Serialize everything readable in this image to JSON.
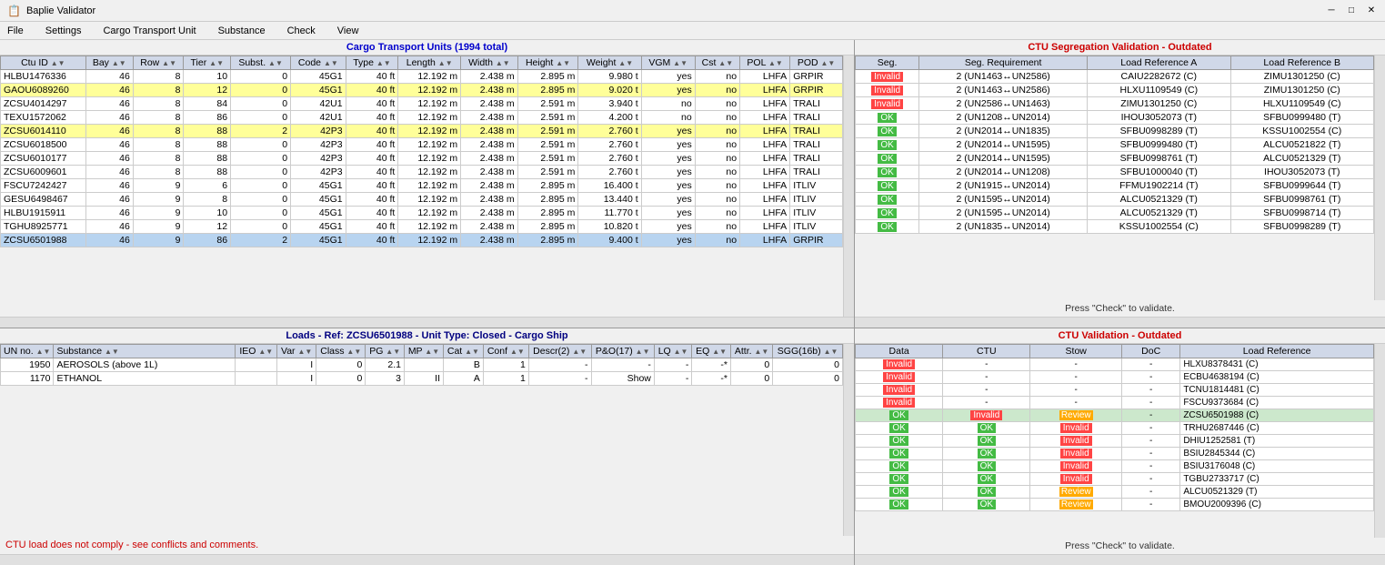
{
  "app": {
    "title": "Baplie Validator",
    "icon": "📋"
  },
  "menu": {
    "items": [
      "File",
      "Settings",
      "Cargo Transport Unit",
      "Substance",
      "Check",
      "View"
    ]
  },
  "ctu_section": {
    "title": "Cargo Transport Units (1994 total)",
    "columns": [
      "Ctu ID",
      "Bay",
      "Row",
      "Tier",
      "Subst.",
      "Code",
      "Type",
      "Length",
      "Width",
      "Height",
      "Weight",
      "VGM",
      "Cst",
      "POL",
      "POD"
    ],
    "rows": [
      {
        "id": "HLBU1476336",
        "bay": "46",
        "row": "8",
        "tier": "10",
        "subst": "0",
        "code": "45G1",
        "type": "40 ft",
        "length": "12.192 m",
        "width": "2.438 m",
        "height": "2.895 m",
        "weight": "9.980 t",
        "vgm": "yes",
        "cst": "no",
        "pol": "LHFA",
        "pod": "GRPIR",
        "style": "normal"
      },
      {
        "id": "GAOU6089260",
        "bay": "46",
        "row": "8",
        "tier": "12",
        "subst": "0",
        "code": "45G1",
        "type": "40 ft",
        "length": "12.192 m",
        "width": "2.438 m",
        "height": "2.895 m",
        "weight": "9.020 t",
        "vgm": "yes",
        "cst": "no",
        "pol": "LHFA",
        "pod": "GRPIR",
        "style": "yellow"
      },
      {
        "id": "ZCSU4014297",
        "bay": "46",
        "row": "8",
        "tier": "84",
        "subst": "0",
        "code": "42U1",
        "type": "40 ft",
        "length": "12.192 m",
        "width": "2.438 m",
        "height": "2.591 m",
        "weight": "3.940 t",
        "vgm": "no",
        "cst": "no",
        "pol": "LHFA",
        "pod": "TRALI",
        "style": "normal"
      },
      {
        "id": "TEXU1572062",
        "bay": "46",
        "row": "8",
        "tier": "86",
        "subst": "0",
        "code": "42U1",
        "type": "40 ft",
        "length": "12.192 m",
        "width": "2.438 m",
        "height": "2.591 m",
        "weight": "4.200 t",
        "vgm": "no",
        "cst": "no",
        "pol": "LHFA",
        "pod": "TRALI",
        "style": "normal"
      },
      {
        "id": "ZCSU6014110",
        "bay": "46",
        "row": "8",
        "tier": "88",
        "subst": "2",
        "code": "42P3",
        "type": "40 ft",
        "length": "12.192 m",
        "width": "2.438 m",
        "height": "2.591 m",
        "weight": "2.760 t",
        "vgm": "yes",
        "cst": "no",
        "pol": "LHFA",
        "pod": "TRALI",
        "style": "yellow"
      },
      {
        "id": "ZCSU6018500",
        "bay": "46",
        "row": "8",
        "tier": "88",
        "subst": "0",
        "code": "42P3",
        "type": "40 ft",
        "length": "12.192 m",
        "width": "2.438 m",
        "height": "2.591 m",
        "weight": "2.760 t",
        "vgm": "yes",
        "cst": "no",
        "pol": "LHFA",
        "pod": "TRALI",
        "style": "normal"
      },
      {
        "id": "ZCSU6010177",
        "bay": "46",
        "row": "8",
        "tier": "88",
        "subst": "0",
        "code": "42P3",
        "type": "40 ft",
        "length": "12.192 m",
        "width": "2.438 m",
        "height": "2.591 m",
        "weight": "2.760 t",
        "vgm": "yes",
        "cst": "no",
        "pol": "LHFA",
        "pod": "TRALI",
        "style": "normal"
      },
      {
        "id": "ZCSU6009601",
        "bay": "46",
        "row": "8",
        "tier": "88",
        "subst": "0",
        "code": "42P3",
        "type": "40 ft",
        "length": "12.192 m",
        "width": "2.438 m",
        "height": "2.591 m",
        "weight": "2.760 t",
        "vgm": "yes",
        "cst": "no",
        "pol": "LHFA",
        "pod": "TRALI",
        "style": "normal"
      },
      {
        "id": "FSCU7242427",
        "bay": "46",
        "row": "9",
        "tier": "6",
        "subst": "0",
        "code": "45G1",
        "type": "40 ft",
        "length": "12.192 m",
        "width": "2.438 m",
        "height": "2.895 m",
        "weight": "16.400 t",
        "vgm": "yes",
        "cst": "no",
        "pol": "LHFA",
        "pod": "ITLIV",
        "style": "normal"
      },
      {
        "id": "GESU6498467",
        "bay": "46",
        "row": "9",
        "tier": "8",
        "subst": "0",
        "code": "45G1",
        "type": "40 ft",
        "length": "12.192 m",
        "width": "2.438 m",
        "height": "2.895 m",
        "weight": "13.440 t",
        "vgm": "yes",
        "cst": "no",
        "pol": "LHFA",
        "pod": "ITLIV",
        "style": "normal"
      },
      {
        "id": "HLBU1915911",
        "bay": "46",
        "row": "9",
        "tier": "10",
        "subst": "0",
        "code": "45G1",
        "type": "40 ft",
        "length": "12.192 m",
        "width": "2.438 m",
        "height": "2.895 m",
        "weight": "11.770 t",
        "vgm": "yes",
        "cst": "no",
        "pol": "LHFA",
        "pod": "ITLIV",
        "style": "normal"
      },
      {
        "id": "TGHU8925771",
        "bay": "46",
        "row": "9",
        "tier": "12",
        "subst": "0",
        "code": "45G1",
        "type": "40 ft",
        "length": "12.192 m",
        "width": "2.438 m",
        "height": "2.895 m",
        "weight": "10.820 t",
        "vgm": "yes",
        "cst": "no",
        "pol": "LHFA",
        "pod": "ITLIV",
        "style": "normal"
      },
      {
        "id": "ZCSU6501988",
        "bay": "46",
        "row": "9",
        "tier": "86",
        "subst": "2",
        "code": "45G1",
        "type": "40 ft",
        "length": "12.192 m",
        "width": "2.438 m",
        "height": "2.895 m",
        "weight": "9.400 t",
        "vgm": "yes",
        "cst": "no",
        "pol": "LHFA",
        "pod": "GRPIR",
        "style": "selected"
      }
    ]
  },
  "loads_section": {
    "title": "Loads - Ref: ZCSU6501988 - Unit Type: Closed - Cargo Ship",
    "columns": [
      "UN no.",
      "Substance",
      "IEO",
      "Var",
      "Class",
      "PG",
      "MP",
      "Cat",
      "Conf",
      "Descr(2)",
      "P&O(17)",
      "LQ",
      "EQ",
      "Attr.",
      "SGG(16b)"
    ],
    "rows": [
      {
        "un": "1950",
        "substance": "AEROSOLS (above 1L)",
        "ieo": "",
        "var": "I",
        "class": "0",
        "pg": "2.1",
        "mp": "",
        "cat": "B",
        "conf": "1",
        "descr2": "-",
        "po17": "-",
        "lq": "-",
        "eq": "-*",
        "attr": "0",
        "sgg": "0"
      },
      {
        "un": "1170",
        "substance": "ETHANOL",
        "ieo": "",
        "var": "I",
        "class": "0",
        "pg": "3",
        "mp": "II",
        "cat": "A",
        "conf": "1",
        "descr2": "-",
        "po17": "Show",
        "lq": "-",
        "eq": "-*",
        "attr": "0",
        "sgg": "0"
      }
    ],
    "error": "CTU load does not comply - see conflicts and comments."
  },
  "segregation_section": {
    "title": "CTU Segregation Validation - Outdated",
    "columns": [
      "Seg.",
      "Seg. Requirement",
      "Load Reference A",
      "Load Reference B"
    ],
    "rows": [
      {
        "seg": "Invalid",
        "req": "2 (UN1463↔UN2586)",
        "refA": "CAIU2282672 (C)",
        "refB": "ZIMU1301250 (C)",
        "style": "invalid"
      },
      {
        "seg": "Invalid",
        "req": "2 (UN1463↔UN2586)",
        "refA": "HLXU1109549 (C)",
        "refB": "ZIMU1301250 (C)",
        "style": "invalid"
      },
      {
        "seg": "Invalid",
        "req": "2 (UN2586↔UN1463)",
        "refA": "ZIMU1301250 (C)",
        "refB": "HLXU1109549 (C)",
        "style": "invalid"
      },
      {
        "seg": "OK",
        "req": "2 (UN1208↔UN2014)",
        "refA": "IHOU3052073 (T)",
        "refB": "SFBU0999480 (T)",
        "style": "ok"
      },
      {
        "seg": "OK",
        "req": "2 (UN2014↔UN1835)",
        "refA": "SFBU0998289 (T)",
        "refB": "KSSU1002554 (C)",
        "style": "ok"
      },
      {
        "seg": "OK",
        "req": "2 (UN2014↔UN1595)",
        "refA": "SFBU0999480 (T)",
        "refB": "ALCU0521822 (T)",
        "style": "ok"
      },
      {
        "seg": "OK",
        "req": "2 (UN2014↔UN1595)",
        "refA": "SFBU0998761 (T)",
        "refB": "ALCU0521329 (T)",
        "style": "ok"
      },
      {
        "seg": "OK",
        "req": "2 (UN2014↔UN1208)",
        "refA": "SFBU1000040 (T)",
        "refB": "IHOU3052073 (T)",
        "style": "ok"
      },
      {
        "seg": "OK",
        "req": "2 (UN1915↔UN2014)",
        "refA": "FFMU1902214 (T)",
        "refB": "SFBU0999644 (T)",
        "style": "ok"
      },
      {
        "seg": "OK",
        "req": "2 (UN1595↔UN2014)",
        "refA": "ALCU0521329 (T)",
        "refB": "SFBU0998761 (T)",
        "style": "ok"
      },
      {
        "seg": "OK",
        "req": "2 (UN1595↔UN2014)",
        "refA": "ALCU0521329 (T)",
        "refB": "SFBU0998714 (T)",
        "style": "ok"
      },
      {
        "seg": "OK",
        "req": "2 (UN1835↔UN2014)",
        "refA": "KSSU1002554 (C)",
        "refB": "SFBU0998289 (T)",
        "style": "ok"
      }
    ],
    "press_check": "Press \"Check\" to validate."
  },
  "ctu_validation_section": {
    "title": "CTU Validation - Outdated",
    "columns": [
      "Data",
      "CTU",
      "Stow",
      "DoC",
      "Load Reference"
    ],
    "rows": [
      {
        "data": "Invalid",
        "ctu": "-",
        "stow": "-",
        "doc": "-",
        "ref": "HLXU8378431 (C)",
        "d_style": "invalid",
        "c_style": "",
        "s_style": "",
        "dc_style": ""
      },
      {
        "data": "Invalid",
        "ctu": "-",
        "stow": "-",
        "doc": "-",
        "ref": "ECBU4638194 (C)",
        "d_style": "invalid",
        "c_style": "",
        "s_style": "",
        "dc_style": ""
      },
      {
        "data": "Invalid",
        "ctu": "-",
        "stow": "-",
        "doc": "-",
        "ref": "TCNU1814481 (C)",
        "d_style": "invalid",
        "c_style": "",
        "s_style": "",
        "dc_style": ""
      },
      {
        "data": "Invalid",
        "ctu": "-",
        "stow": "-",
        "doc": "-",
        "ref": "FSCU9373684 (C)",
        "d_style": "invalid",
        "c_style": "",
        "s_style": "",
        "dc_style": ""
      },
      {
        "data": "OK",
        "ctu": "Invalid",
        "stow": "Review",
        "doc": "-",
        "ref": "ZCSU6501988 (C)",
        "d_style": "ok",
        "c_style": "invalid",
        "s_style": "review",
        "dc_style": "",
        "row_selected": true
      },
      {
        "data": "OK",
        "ctu": "OK",
        "stow": "Invalid",
        "doc": "-",
        "ref": "TRHU2687446 (C)",
        "d_style": "ok",
        "c_style": "ok",
        "s_style": "invalid",
        "dc_style": ""
      },
      {
        "data": "OK",
        "ctu": "OK",
        "stow": "Invalid",
        "doc": "-",
        "ref": "DHIU1252581 (T)",
        "d_style": "ok",
        "c_style": "ok",
        "s_style": "invalid",
        "dc_style": ""
      },
      {
        "data": "OK",
        "ctu": "OK",
        "stow": "Invalid",
        "doc": "-",
        "ref": "BSIU2845344 (C)",
        "d_style": "ok",
        "c_style": "ok",
        "s_style": "invalid",
        "dc_style": ""
      },
      {
        "data": "OK",
        "ctu": "OK",
        "stow": "Invalid",
        "doc": "-",
        "ref": "BSIU3176048 (C)",
        "d_style": "ok",
        "c_style": "ok",
        "s_style": "invalid",
        "dc_style": ""
      },
      {
        "data": "OK",
        "ctu": "OK",
        "stow": "Invalid",
        "doc": "-",
        "ref": "TGBU2733717 (C)",
        "d_style": "ok",
        "c_style": "ok",
        "s_style": "invalid",
        "dc_style": ""
      },
      {
        "data": "OK",
        "ctu": "OK",
        "stow": "Review",
        "doc": "-",
        "ref": "ALCU0521329 (T)",
        "d_style": "ok",
        "c_style": "ok",
        "s_style": "review",
        "dc_style": ""
      },
      {
        "data": "OK",
        "ctu": "OK",
        "stow": "Review",
        "doc": "-",
        "ref": "BMOU2009396 (C)",
        "d_style": "ok",
        "c_style": "ok",
        "s_style": "review",
        "dc_style": ""
      }
    ],
    "press_check": "Press \"Check\" to validate."
  }
}
